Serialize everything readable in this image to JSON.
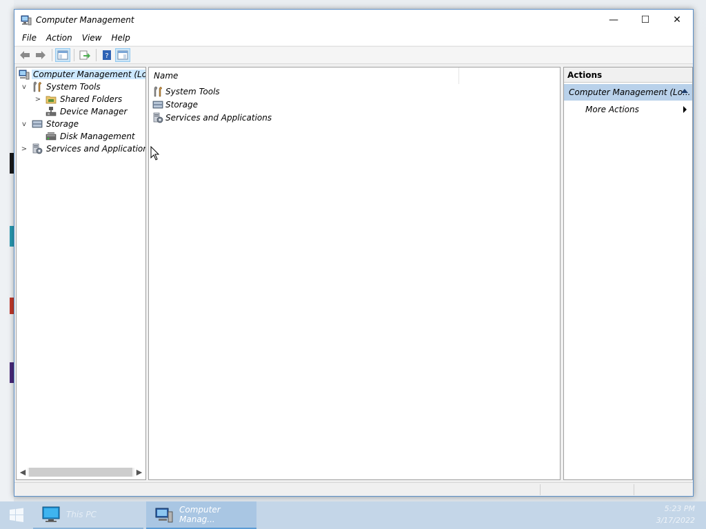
{
  "window": {
    "title": "Computer Management",
    "controls": {
      "minimize": "—",
      "maximize": "☐",
      "close": "✕"
    }
  },
  "menu": [
    "File",
    "Action",
    "View",
    "Help"
  ],
  "toolbar": {
    "buttons": [
      "back-arrow-icon",
      "forward-arrow-icon",
      "show-hide-console-tree-icon",
      "export-list-icon",
      "help-icon",
      "show-hide-action-pane-icon"
    ]
  },
  "tree": {
    "root": "Computer Management (Local)",
    "system_tools": "System Tools",
    "shared_folders": "Shared Folders",
    "device_manager": "Device Manager",
    "storage": "Storage",
    "disk_management": "Disk Management",
    "services_apps": "Services and Applications",
    "expander_open": "v",
    "expander_closed": ">"
  },
  "list": {
    "columns": [
      "Name",
      ""
    ],
    "rows": [
      "System Tools",
      "Storage",
      "Services and Applications"
    ]
  },
  "actions": {
    "header": "Actions",
    "group": "Computer Management (Lo...",
    "items": [
      "More Actions"
    ]
  },
  "taskbar": {
    "items": [
      "This PC",
      "Computer Manag..."
    ],
    "time": "5:23 PM",
    "date": "3/17/2022"
  },
  "colors": {
    "selection": "#cce8ff",
    "action_group": "#b9d1ea",
    "taskbar": "#c4d6e8",
    "window_border": "#5b8fc7"
  }
}
